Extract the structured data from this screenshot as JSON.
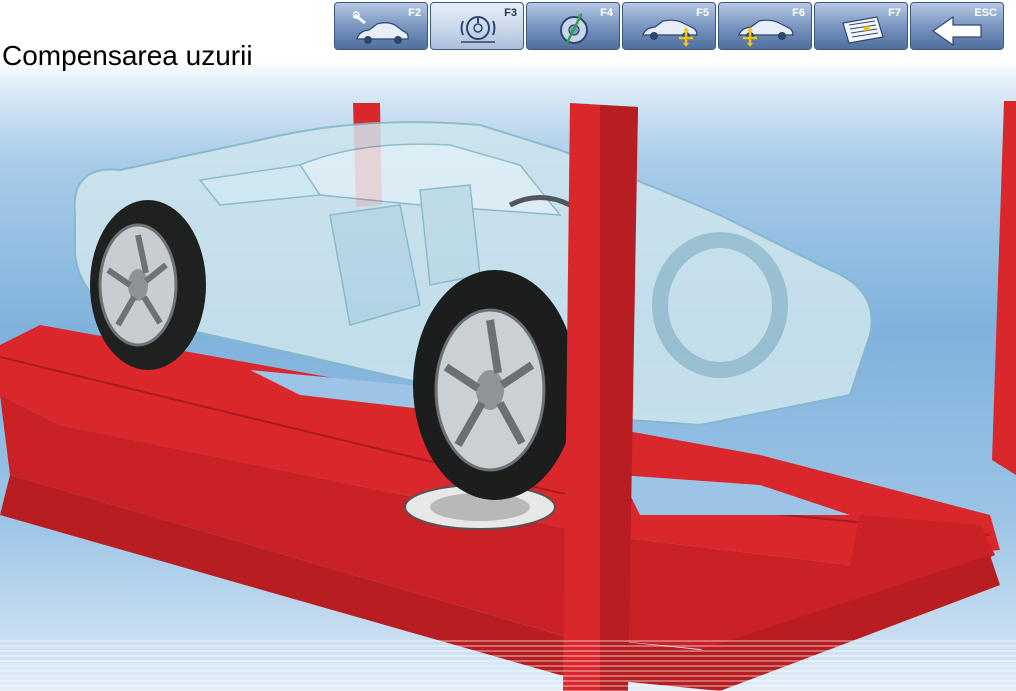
{
  "screen": {
    "title": "Compensarea uzurii"
  },
  "toolbar": {
    "buttons": [
      {
        "key": "F2",
        "icon": "car-tools-icon"
      },
      {
        "key": "F3",
        "icon": "runout-compensation-icon",
        "active": true
      },
      {
        "key": "F4",
        "icon": "wheel-alignment-icon"
      },
      {
        "key": "F5",
        "icon": "front-axle-car-icon"
      },
      {
        "key": "F6",
        "icon": "rear-axle-car-icon"
      },
      {
        "key": "F7",
        "icon": "printer-report-icon"
      },
      {
        "key": "ESC",
        "icon": "back-arrow-icon"
      }
    ]
  },
  "colors": {
    "lift_red": "#d9272b",
    "button_blue": "#5a77a6",
    "active_button": "#c8d6ea"
  }
}
